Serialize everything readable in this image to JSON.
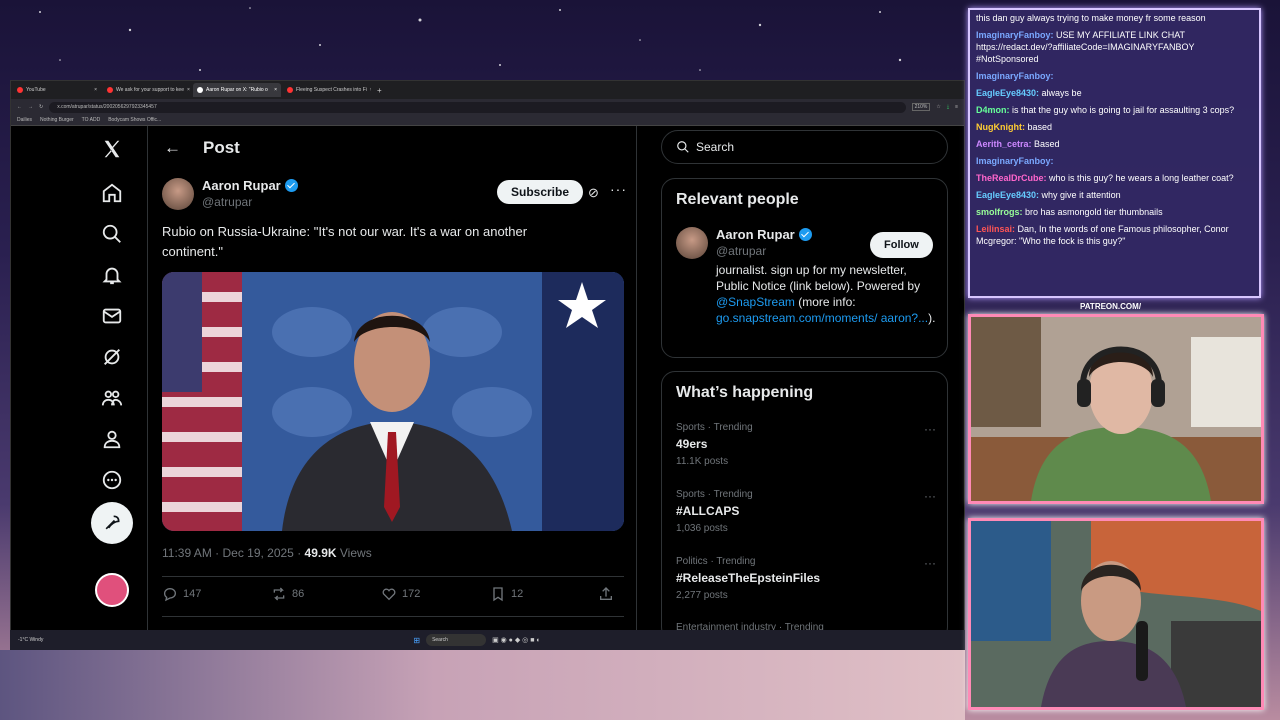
{
  "browser": {
    "tabs": [
      {
        "label": "YouTube",
        "active": false
      },
      {
        "label": "We ask for your support to kee",
        "active": false
      },
      {
        "label": "Aaron Rupar on X: \"Rubio o",
        "active": true
      },
      {
        "label": "Fleeing Suspect Crashes into Fi",
        "active": false
      }
    ],
    "url": "x.com/atrupar/status/2002056297923345457",
    "zoom": "210%",
    "bookmarks": [
      "Dailies",
      "Nothing Burger",
      "TO ADD",
      "Bodycam Shows Offic..."
    ]
  },
  "post": {
    "header_title": "Post",
    "author_name": "Aaron Rupar",
    "author_handle": "@atrupar",
    "subscribe_label": "Subscribe",
    "text": "Rubio on Russia-Ukraine: \"It's not our war. It's a war on another continent.\"",
    "time": "11:39 AM · Dec 19, 2025 · ",
    "views_count": "49.9K",
    "views_label": " Views",
    "replies": "147",
    "reposts": "86",
    "likes": "172",
    "bookmarks": "12"
  },
  "sidebar": {
    "search_placeholder": "Search",
    "relevant_title": "Relevant people",
    "person_name": "Aaron Rupar",
    "person_handle": "@atrupar",
    "follow_label": "Follow",
    "bio_text": "journalist. sign up for my newsletter, Public Notice (link below). Powered by ",
    "bio_link1": "@SnapStream",
    "bio_mid": " (more info: ",
    "bio_link2": "go.snapstream.com/moments/ aaron?...",
    "bio_end": ").",
    "happening_title": "What’s happening",
    "trends": [
      {
        "meta": "Sports · Trending",
        "title": "49ers",
        "count": "11.1K posts"
      },
      {
        "meta": "Sports · Trending",
        "title": "#ALLCAPS",
        "count": "1,036 posts"
      },
      {
        "meta": "Politics · Trending",
        "title": "#ReleaseTheEpsteinFiles",
        "count": "2,277 posts"
      },
      {
        "meta": "Entertainment industry · Trending",
        "title": "",
        "count": ""
      }
    ]
  },
  "taskbar": {
    "weather_temp": "-1°C",
    "weather_text": "Windy",
    "search_label": "Search"
  },
  "chat": {
    "messages": [
      {
        "user": "",
        "text": "this dan guy always trying to make money fr some reason",
        "color": "#9ad0ff"
      },
      {
        "user": "ImaginaryFanboy:",
        "text": "USE MY AFFILIATE LINK CHAT https://redact.dev/?affiliateCode=IMAGINARYFANBOY #NotSponsored",
        "color": "#7aa8ff"
      },
      {
        "user": "ImaginaryFanboy:",
        "text": "",
        "color": "#7aa8ff"
      },
      {
        "user": "EagleEye8430:",
        "text": "always be",
        "color": "#66ccff"
      },
      {
        "user": "D4mon:",
        "text": "is that the guy who is going to jail for assaulting 3 cops?",
        "color": "#66ff99"
      },
      {
        "user": "NugKnight:",
        "text": "based",
        "color": "#ffcc33"
      },
      {
        "user": "Aerith_cetra:",
        "text": "Based",
        "color": "#cc88ff"
      },
      {
        "user": "ImaginaryFanboy:",
        "text": "",
        "color": "#7aa8ff"
      },
      {
        "user": "TheRealDrCube:",
        "text": "who is this guy? he wears a long leather coat?",
        "color": "#ff66cc"
      },
      {
        "user": "EagleEye8430:",
        "text": "why give it attention",
        "color": "#66ccff"
      },
      {
        "user": "smolfrogs:",
        "text": "bro has asmongold tier thumbnails",
        "color": "#99ff99"
      },
      {
        "user": "Leilinsai:",
        "text": "Dan, In the words of one Famous philosopher, Conor Mcgregor: \"Who the fock is this guy?\"",
        "color": "#ff5555"
      }
    ]
  },
  "overlay": {
    "patreon": "PATREON.COM/"
  }
}
